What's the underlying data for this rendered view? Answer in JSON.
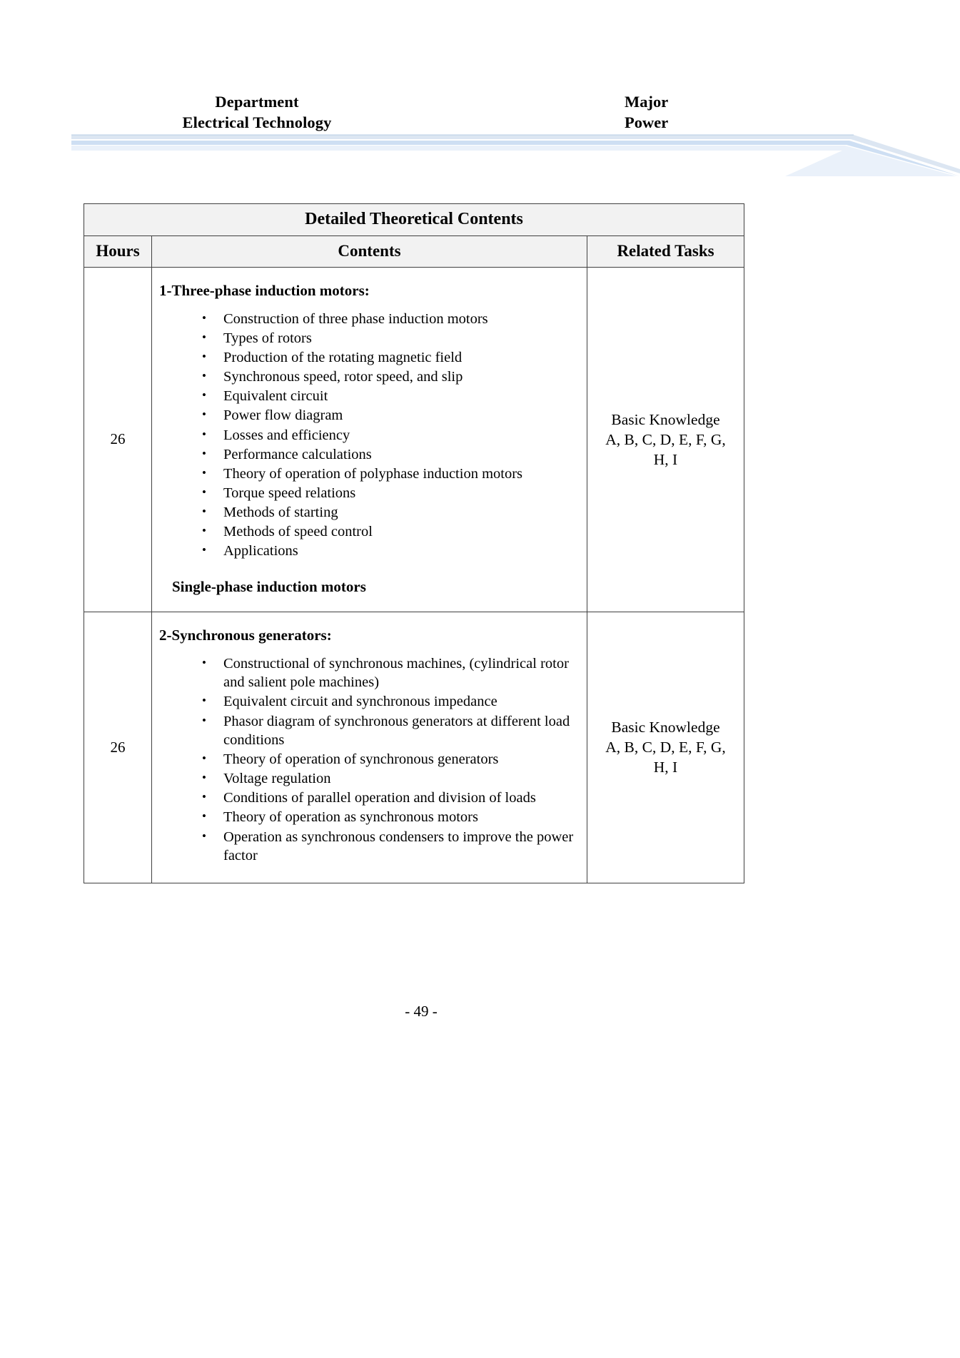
{
  "header": {
    "left_line1": "Department",
    "left_line2": "Electrical Technology",
    "right_line1": "Major",
    "right_line2": "Power"
  },
  "divider": {
    "color_light": "#dce6f2",
    "color_mid": "#c5d9f1",
    "color_pale": "#eaf1fa"
  },
  "table": {
    "title": "Detailed Theoretical Contents",
    "columns": {
      "hours": "Hours",
      "contents": "Contents",
      "related_tasks": "Related Tasks"
    },
    "rows": [
      {
        "hours": "26",
        "heading": "1-Three-phase induction motors:",
        "bullets": [
          "Construction of three phase induction motors",
          "Types of rotors",
          "Production of the rotating magnetic field",
          "Synchronous speed, rotor speed, and slip",
          "Equivalent circuit",
          "Power flow diagram",
          "Losses and efficiency",
          "Performance calculations",
          "Theory of operation of polyphase induction motors",
          "Torque speed relations",
          "Methods of starting",
          "Methods of speed control",
          "Applications"
        ],
        "footer": "Single-phase induction motors",
        "related_tasks_line1": "Basic Knowledge",
        "related_tasks_line2": "A, B, C, D, E, F, G,",
        "related_tasks_line3": "H, I"
      },
      {
        "hours": "26",
        "heading": "2-Synchronous generators:",
        "bullets": [
          "Constructional of synchronous machines, (cylindrical rotor and salient pole machines)",
          "Equivalent circuit and synchronous impedance",
          "Phasor diagram of synchronous generators at different load conditions",
          "Theory of operation of synchronous generators",
          "Voltage regulation",
          "Conditions of parallel operation and division of loads",
          "Theory of operation as synchronous motors",
          "Operation as synchronous condensers to improve the power factor"
        ],
        "footer": "",
        "related_tasks_line1": "Basic Knowledge",
        "related_tasks_line2": "A, B, C, D, E, F, G,",
        "related_tasks_line3": "H, I"
      }
    ]
  },
  "footer": {
    "page_number": "- 49 -"
  }
}
